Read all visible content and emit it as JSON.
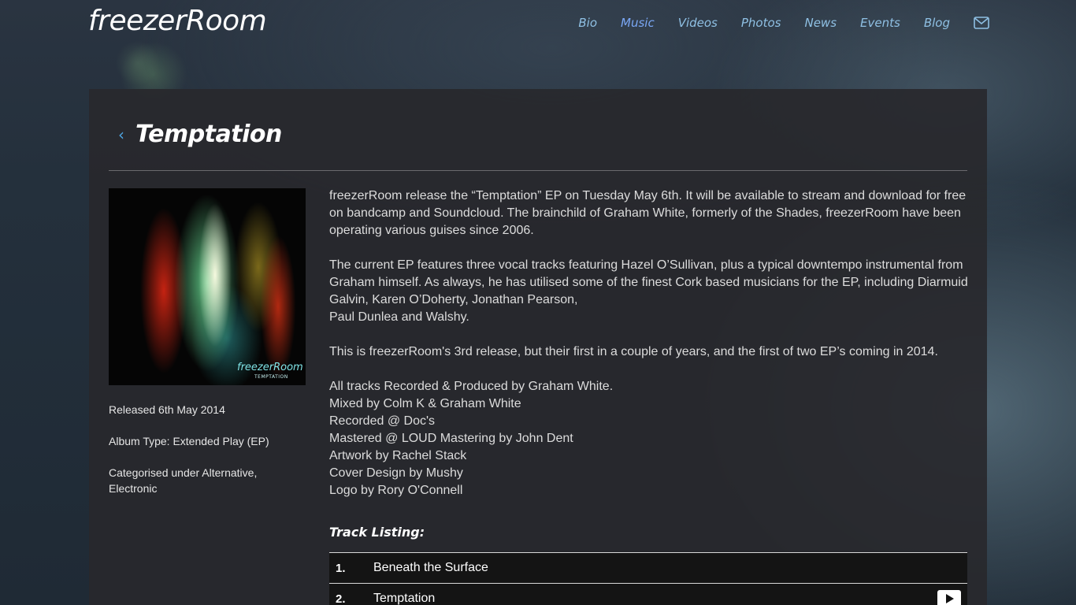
{
  "site": {
    "logo": "freezerRoom"
  },
  "nav": {
    "items": [
      "Bio",
      "Music",
      "Videos",
      "Photos",
      "News",
      "Events",
      "Blog"
    ],
    "active": "Music",
    "mail_icon": "mail-icon"
  },
  "page": {
    "back_icon": "chevron-left-icon",
    "title": "Temptation"
  },
  "cover": {
    "logo_text": "freezerRoom",
    "subtitle": "TEMPTATION"
  },
  "meta": {
    "released": "Released 6th May 2014",
    "album_type": "Album Type: Extended Play (EP)",
    "categories": "Categorised under Alternative, Electronic"
  },
  "description": {
    "p1": "freezerRoom release the “Temptation” EP on Tuesday May 6th. It will be available to stream and download for free on bandcamp and Soundcloud. The brainchild of Graham White, formerly of the Shades, freezerRoom have been operating various guises since 2006.",
    "p2_line1": "The current EP features three vocal tracks featuring Hazel O’Sullivan, plus a typical downtempo instrumental from Graham himself. As always, he has utilised some of the finest Cork based musicians for the EP, including Diarmuid Galvin, Karen O’Doherty, Jonathan Pearson,",
    "p2_line2": "Paul Dunlea and Walshy.",
    "p3": "This is freezerRoom's 3rd release, but their first in a couple of years, and the first of two EP’s coming in 2014."
  },
  "credits": [
    "All tracks Recorded & Produced by Graham White.",
    "Mixed by Colm K & Graham White",
    "Recorded @ Doc's",
    "Mastered @ LOUD Mastering by John Dent",
    "Artwork by Rachel Stack",
    "Cover Design by Mushy",
    "Logo by Rory O'Connell"
  ],
  "tracks": {
    "heading": "Track Listing:",
    "items": [
      {
        "num": "1.",
        "name": "Beneath the Surface"
      },
      {
        "num": "2.",
        "name": "Temptation"
      }
    ]
  }
}
